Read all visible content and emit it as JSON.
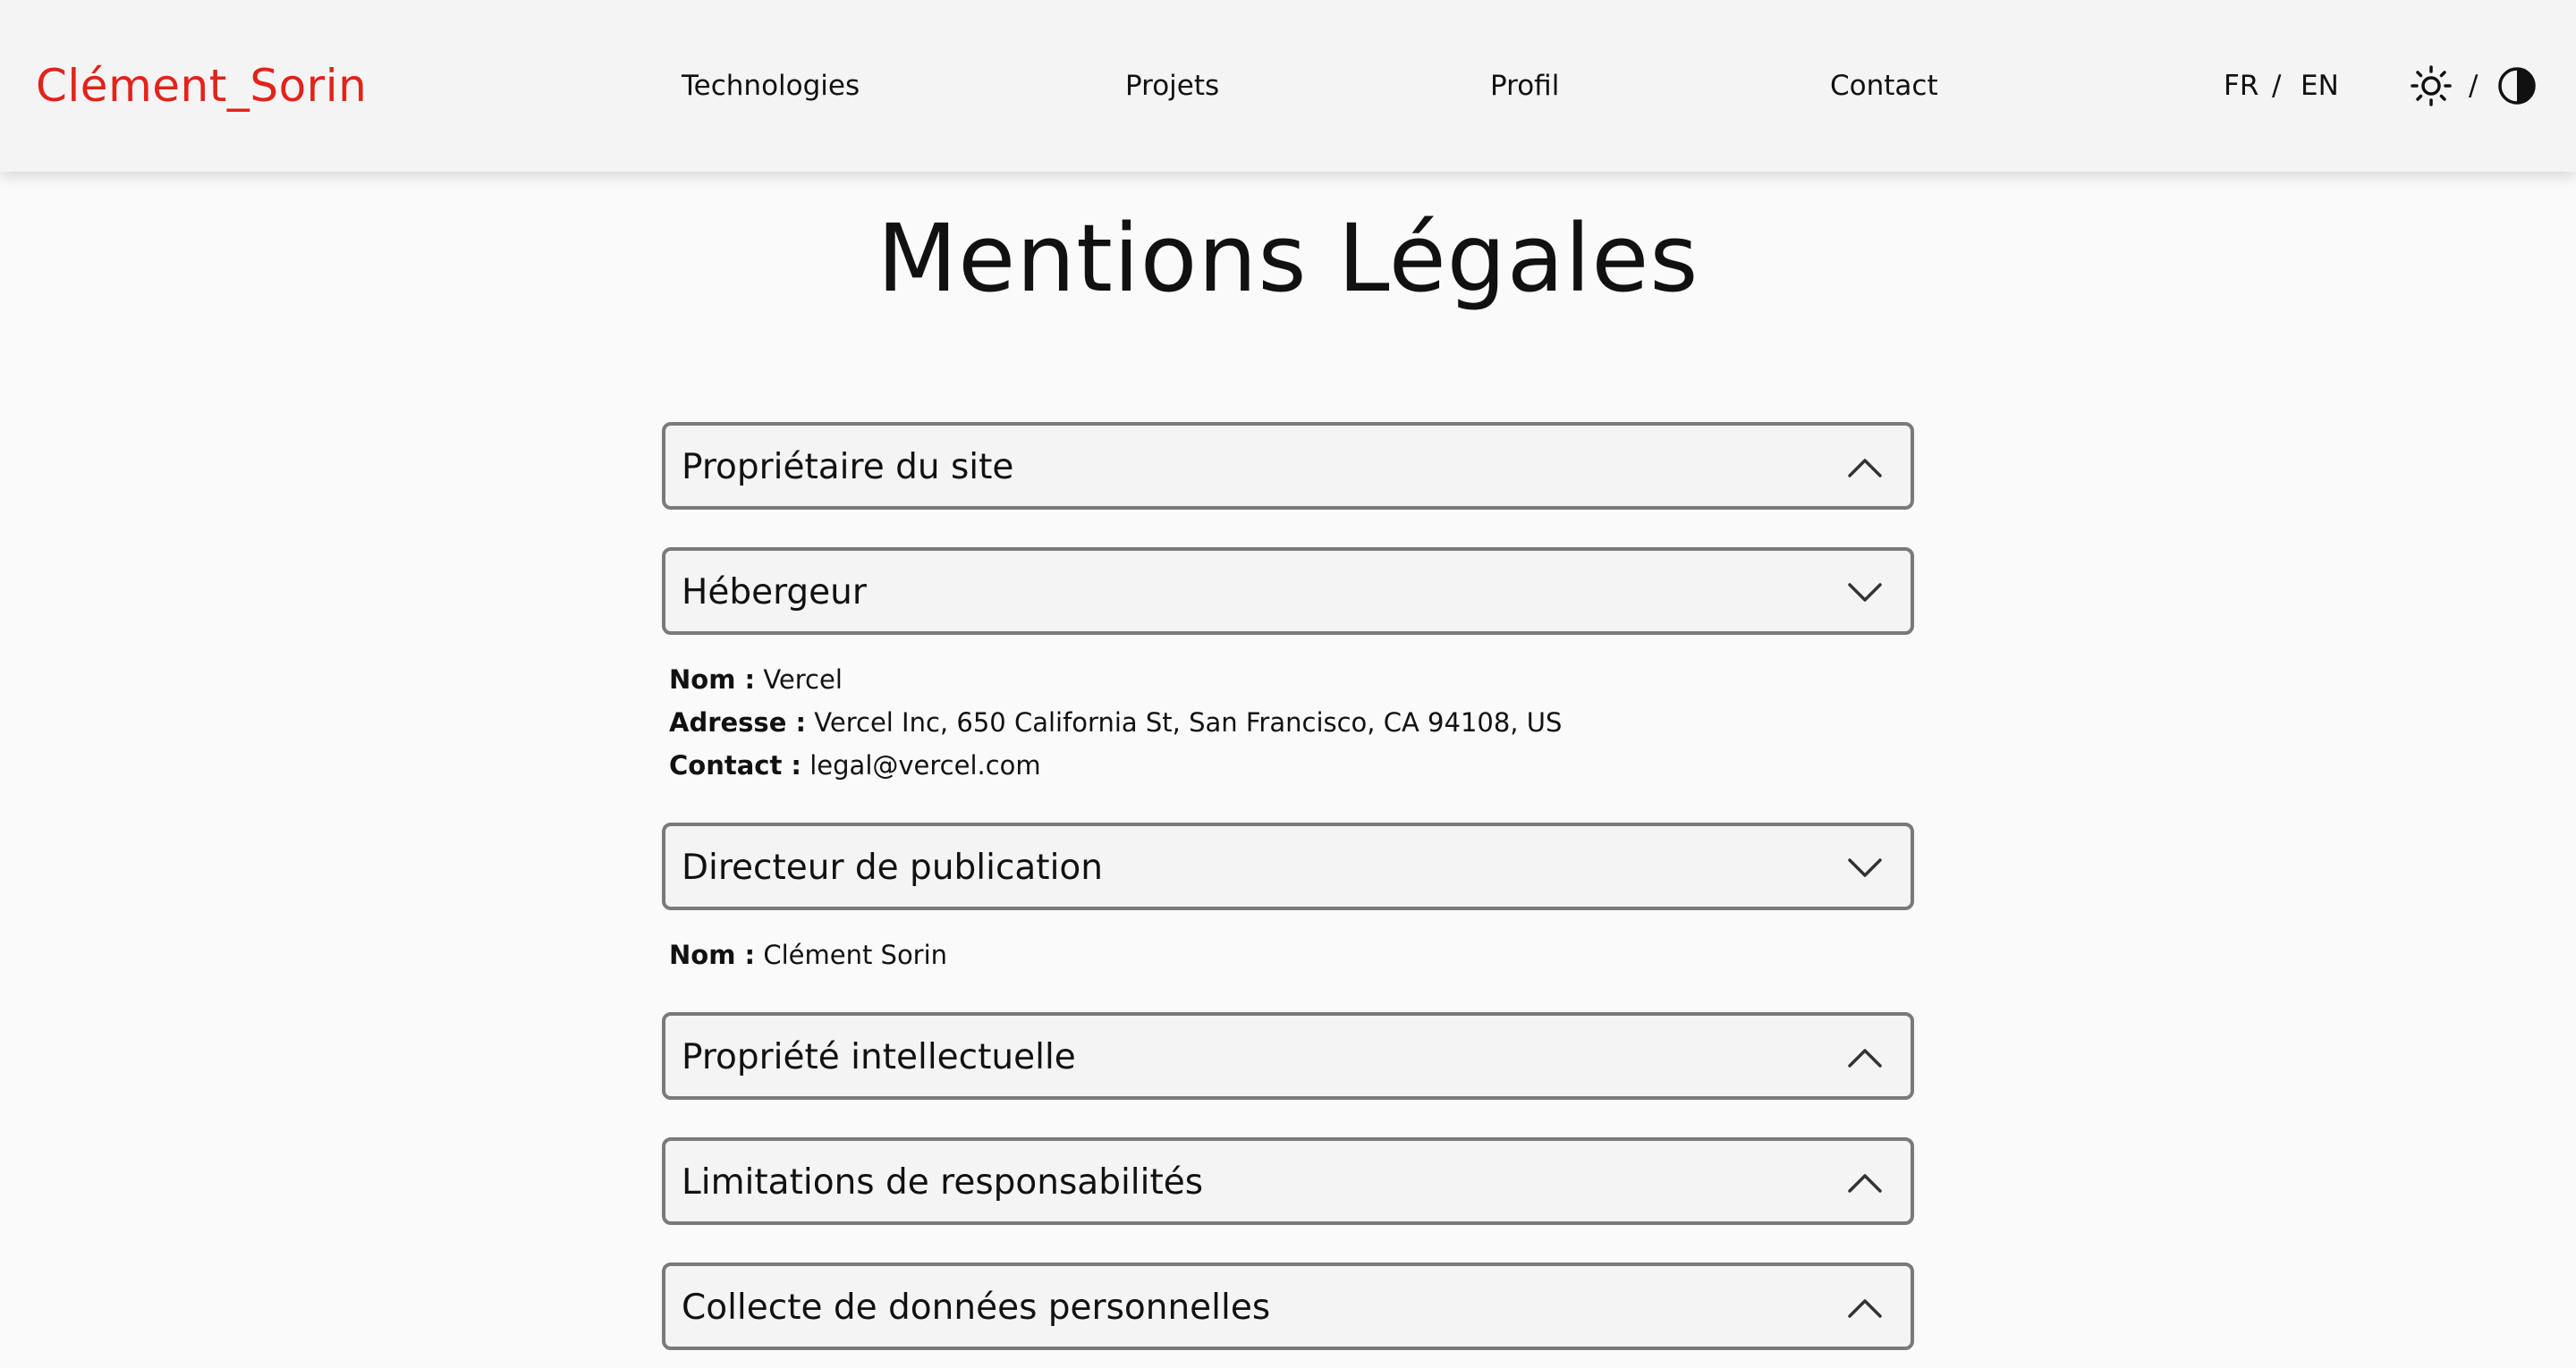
{
  "header": {
    "logo": "Clément_Sorin",
    "nav": [
      "Technologies",
      "Projets",
      "Profil",
      "Contact"
    ],
    "lang_fr": "FR",
    "lang_sep": "/",
    "lang_en": "EN",
    "theme_sep": "/"
  },
  "page": {
    "title": "Mentions Légales"
  },
  "sections": [
    {
      "label": "Propriétaire du site",
      "state": "collapsed"
    },
    {
      "label": "Hébergeur",
      "state": "expanded",
      "details": [
        {
          "key": "Nom :",
          "value": "Vercel"
        },
        {
          "key": "Adresse :",
          "value": "Vercel Inc, 650 California St, San Francisco, CA 94108, US"
        },
        {
          "key": "Contact :",
          "value": "legal@vercel.com"
        }
      ]
    },
    {
      "label": "Directeur de publication",
      "state": "expanded",
      "details": [
        {
          "key": "Nom :",
          "value": "Clément Sorin"
        }
      ]
    },
    {
      "label": "Propriété intellectuelle",
      "state": "collapsed"
    },
    {
      "label": "Limitations de responsabilités",
      "state": "collapsed"
    },
    {
      "label": "Collecte de données personnelles",
      "state": "collapsed"
    }
  ],
  "colors": {
    "brand": "#e2231a",
    "background": "#fafafa",
    "header_bg": "#f4f4f4",
    "border": "#7a7a7a"
  },
  "icons": {
    "light_theme": "sun-icon",
    "dark_theme": "contrast-icon",
    "collapsed": "chevron-up-icon",
    "expanded": "chevron-down-icon"
  }
}
